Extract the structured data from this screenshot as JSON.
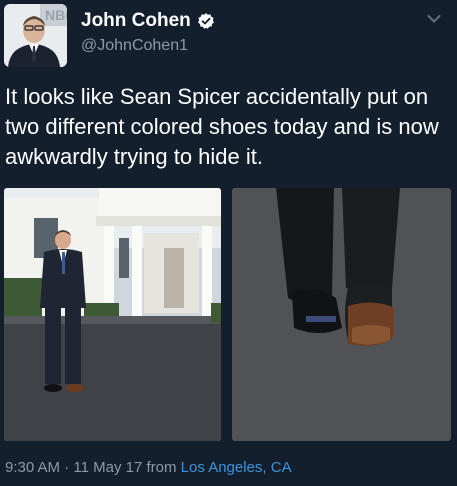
{
  "user": {
    "name": "John Cohen",
    "handle": "@JohnCohen1",
    "avatar_text": "NBC"
  },
  "tweet": {
    "text": "It looks like Sean Spicer accidentally put on two different colored shoes today and is now awkwardly trying to hide it."
  },
  "footer": {
    "time": "9:30 AM",
    "separator": " · ",
    "date": "11 May 17",
    "from_label": " from ",
    "location": "Los Angeles, CA"
  },
  "colors": {
    "background": "#131f2d",
    "text": "#ffffff",
    "secondary": "#8a9aaa",
    "link": "#3b94d9",
    "verified": "#ffffff"
  },
  "icons": [
    "verified-badge-icon",
    "chevron-down-icon"
  ]
}
